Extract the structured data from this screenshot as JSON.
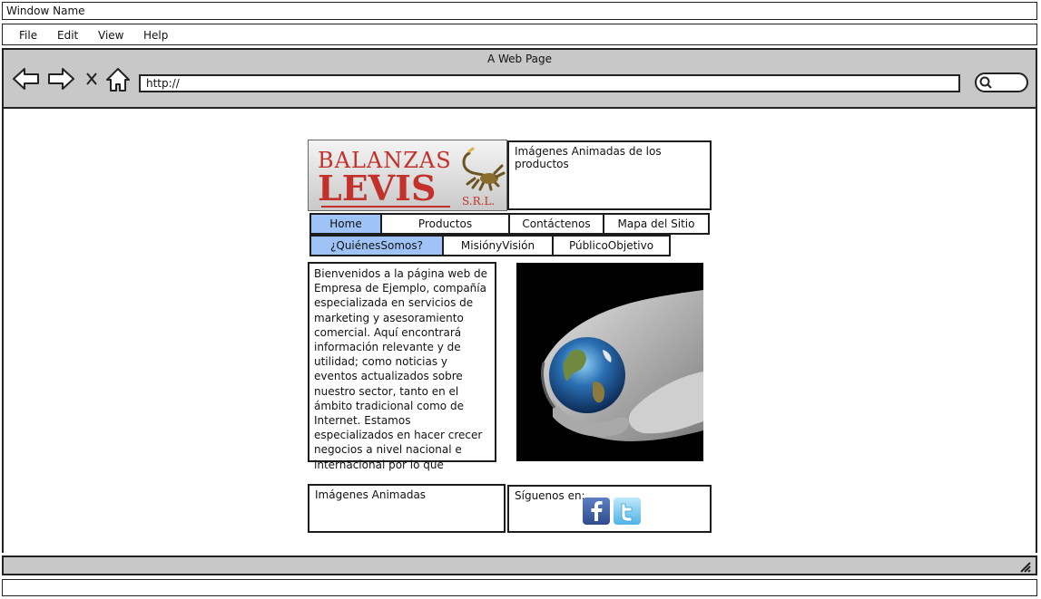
{
  "window": {
    "title": "Window Name"
  },
  "menu": [
    "File",
    "Edit",
    "View",
    "Help"
  ],
  "browser": {
    "page_title": "A Web Page",
    "url": "http://"
  },
  "page": {
    "logo": {
      "line1": "BALANZAS",
      "line2": "LEVIS",
      "suffix": "S.R.L."
    },
    "header_animation_label": "Imágenes Animadas de los productos",
    "nav_primary": [
      "Home",
      "Productos",
      "Contáctenos",
      "Mapa del Sitio"
    ],
    "nav_secondary": [
      "¿QuiénesSomos?",
      "MisiónyVisión",
      "PúblicoObjetivo"
    ],
    "intro_text": "Bienvenidos a la página web de Empresa de Ejemplo, compañía especializada en servicios de marketing y asesoramiento comercial. Aquí encontrará información relevante y de utilidad; como noticias y eventos actualizados sobre nuestro sector, tanto en el ámbito tradicional como de Internet. Estamos especializados en hacer crecer negocios a nivel nacional e internacional por lo que",
    "footer_animation_label": "Imágenes Animadas",
    "social_label": "Síguenos en:",
    "social_icons": [
      "facebook-icon",
      "twitter-icon"
    ]
  },
  "colors": {
    "chrome": "#c8c8c8",
    "tab_active": "#9fc2f7",
    "brand_red": "#c3312b"
  }
}
